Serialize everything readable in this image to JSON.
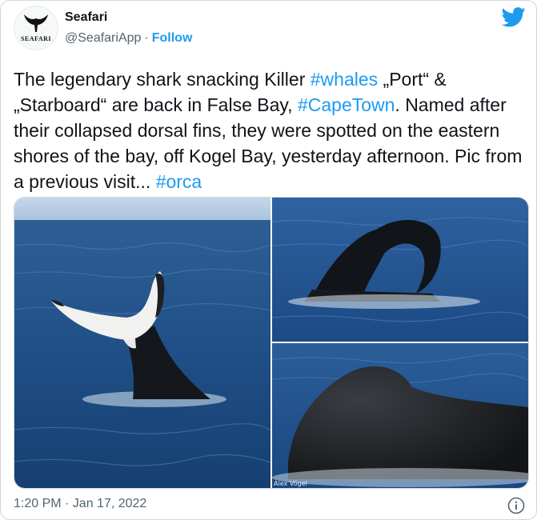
{
  "author": {
    "name": "Seafari",
    "handle": "@SeafariApp",
    "separator": "·",
    "follow_label": "Follow",
    "avatar_text": "SEAFARI"
  },
  "icons": {
    "platform": "twitter-bird-icon",
    "info": "info-icon",
    "brand_color": "#1d9bf0"
  },
  "tweet": {
    "segments": [
      {
        "type": "text",
        "text": "The legendary shark snacking Killer "
      },
      {
        "type": "hashtag",
        "text": "#whales"
      },
      {
        "type": "text",
        "text": " „Port“ & „Starboard“ are back in False Bay, "
      },
      {
        "type": "hashtag",
        "text": "#CapeTown"
      },
      {
        "type": "text",
        "text": ". Named after their collapsed dorsal fins, they were spotted on the eastern shores of the bay, off Kogel Bay, yesterday afternoon. Pic from a previous visit... "
      },
      {
        "type": "hashtag",
        "text": "#orca"
      }
    ]
  },
  "media": {
    "photo_credit": "Alex Vögel"
  },
  "footer": {
    "timestamp": "1:20 PM · Jan 17, 2022"
  }
}
